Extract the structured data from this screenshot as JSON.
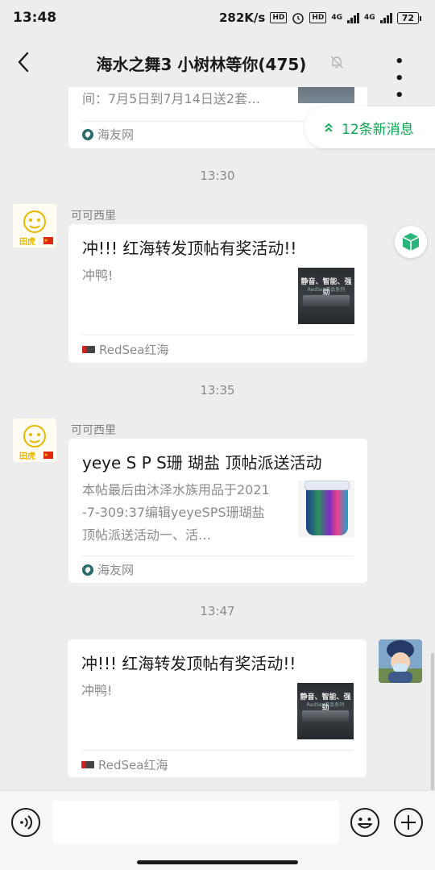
{
  "status_bar": {
    "time": "13:48",
    "net_speed": "282K/s",
    "hd1": "HD",
    "hd2": "HD",
    "net1": "4G",
    "net2": "4G",
    "battery": "72"
  },
  "nav": {
    "title": "海水之舞3 小树林等你(475)"
  },
  "new_messages": {
    "label": "12条新消息"
  },
  "messages": [
    {
      "type": "card",
      "desc": "间：7月5日到7月14日送2套…",
      "source": "海友网"
    },
    {
      "type": "time",
      "text": "13:30"
    },
    {
      "type": "card",
      "sender": "可可西里",
      "title": "冲!!! 红海转发顶帖有奖活动!!",
      "desc": "冲鸭!",
      "thumb_text": "静音、智能、强劲",
      "thumb_sub": "RedSea产品系列",
      "source": "RedSea红海"
    },
    {
      "type": "time",
      "text": "13:35"
    },
    {
      "type": "card",
      "sender": "可可西里",
      "title": "yeye S P S珊 瑚盐 顶帖派送活动",
      "desc": "本帖最后由沐泽水族用品于2021-7-309:37编辑yeyeSPS珊瑚盐顶帖派送活动一、活…",
      "source": "海友网"
    },
    {
      "type": "time",
      "text": "13:47"
    },
    {
      "type": "card",
      "title": "冲!!! 红海转发顶帖有奖活动!!",
      "desc": "冲鸭!",
      "thumb_text": "静音、智能、强劲",
      "thumb_sub": "RedSea产品系列",
      "source": "RedSea红海"
    }
  ],
  "input": {
    "placeholder": ""
  },
  "icons": {
    "back": "back-arrow-icon",
    "mute": "mute-bell-icon",
    "more": "more-icon",
    "voice": "voice-icon",
    "emoji": "emoji-icon",
    "plus": "plus-icon"
  },
  "colors": {
    "accent": "#07a64f",
    "background": "#ededed"
  }
}
